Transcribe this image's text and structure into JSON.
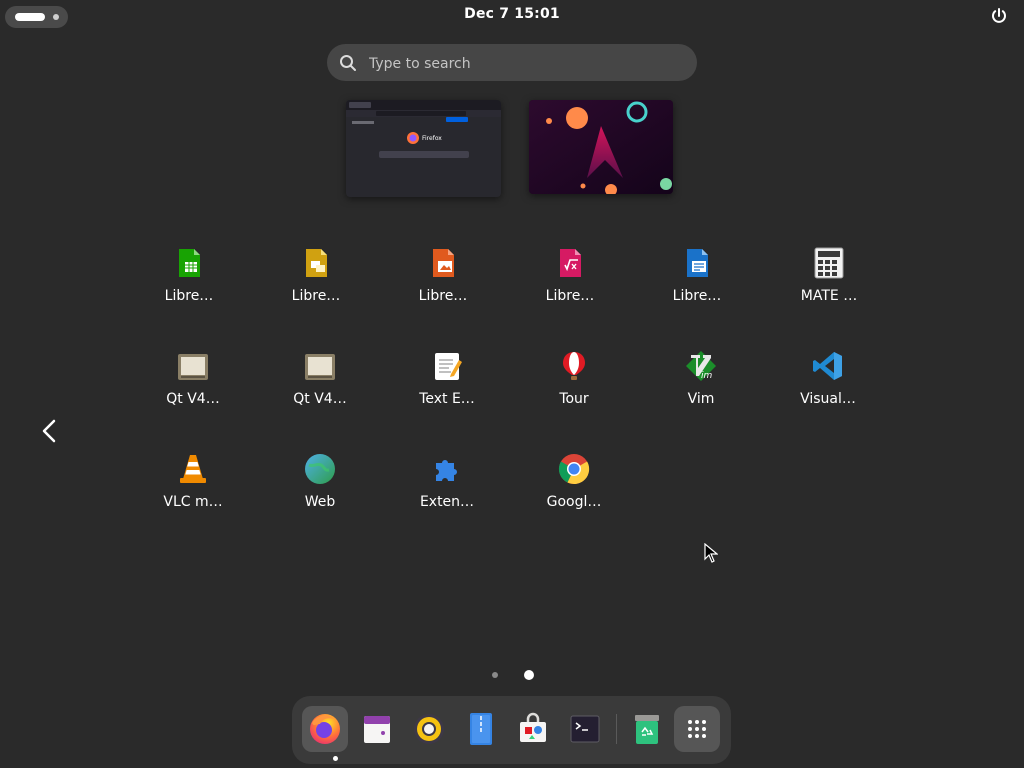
{
  "topbar": {
    "clock": "Dec 7  15:01",
    "activities_icon": "activities-indicator-icon",
    "power_icon": "power-icon"
  },
  "search": {
    "placeholder": "Type to search",
    "icon": "search-icon"
  },
  "workspaces": {
    "firefox_label": "Firefox"
  },
  "apps": [
    {
      "label": "Libre…",
      "icon": "libreoffice-calc-icon"
    },
    {
      "label": "Libre…",
      "icon": "libreoffice-impress-icon"
    },
    {
      "label": "Libre…",
      "icon": "libreoffice-draw-icon"
    },
    {
      "label": "Libre…",
      "icon": "libreoffice-math-icon"
    },
    {
      "label": "Libre…",
      "icon": "libreoffice-writer-icon"
    },
    {
      "label": "MATE …",
      "icon": "calculator-icon"
    },
    {
      "label": "Qt V4…",
      "icon": "qt-v4l2-icon"
    },
    {
      "label": "Qt V4…",
      "icon": "qt-v4l2-icon"
    },
    {
      "label": "Text E…",
      "icon": "text-editor-icon"
    },
    {
      "label": "Tour",
      "icon": "tour-balloon-icon"
    },
    {
      "label": "Vim",
      "icon": "vim-icon"
    },
    {
      "label": "Visual…",
      "icon": "vscode-icon"
    },
    {
      "label": "VLC m…",
      "icon": "vlc-icon"
    },
    {
      "label": "Web",
      "icon": "web-globe-icon"
    },
    {
      "label": "Exten…",
      "icon": "extensions-puzzle-icon"
    },
    {
      "label": "Googl…",
      "icon": "chrome-icon"
    }
  ],
  "pager": {
    "page_count": 2,
    "current_page": 2
  },
  "dock": [
    {
      "name": "firefox",
      "icon": "firefox-icon",
      "running": true
    },
    {
      "name": "calendar",
      "icon": "calendar-icon"
    },
    {
      "name": "rhythmbox",
      "icon": "music-player-icon"
    },
    {
      "name": "files",
      "icon": "file-manager-icon"
    },
    {
      "name": "software",
      "icon": "software-store-icon"
    },
    {
      "name": "terminal",
      "icon": "terminal-icon"
    },
    {
      "name": "trash",
      "icon": "trash-icon"
    },
    {
      "name": "show-apps",
      "icon": "app-grid-icon"
    }
  ]
}
